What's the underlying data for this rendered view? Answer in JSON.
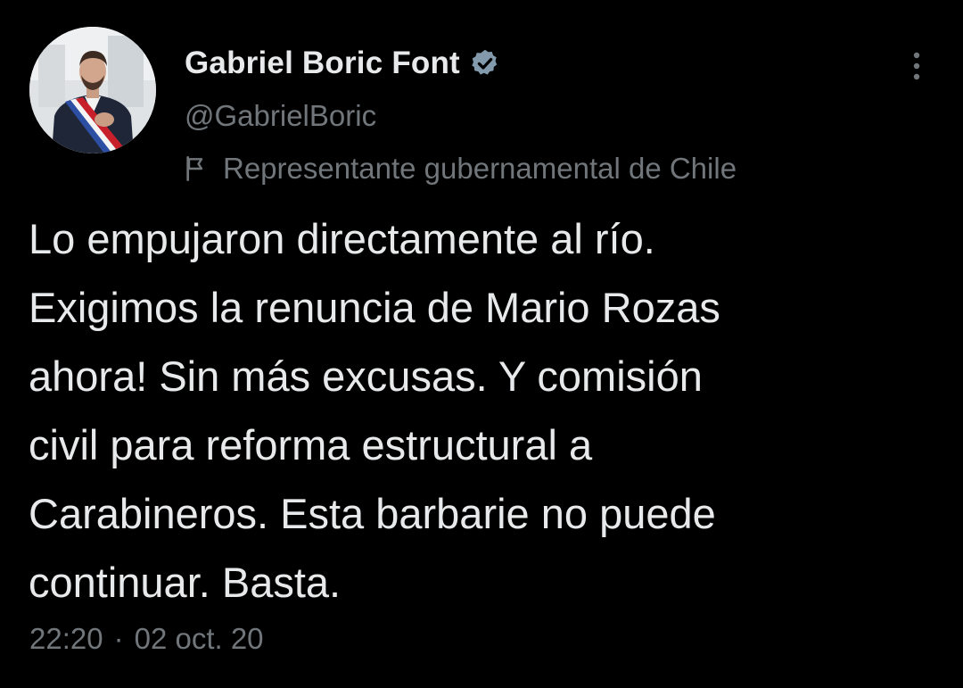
{
  "tweet": {
    "author": {
      "display_name": "Gabriel Boric Font",
      "handle": "@GabrielBoric",
      "verified": true,
      "avatar_icon": "profile-photo",
      "label_icon": "flag-icon",
      "label": "Representante gubernamental de Chile"
    },
    "text": "Lo empujaron directamente al río.\nExigimos la renuncia de Mario Rozas\nahora! Sin más excusas. Y comisión\ncivil para reforma estructural a\nCarabineros. Esta barbarie no puede\ncontinuar. Basta.",
    "time": "22:20",
    "separator": "·",
    "date": "02 oct. 20",
    "more_icon": "more-vertical-icon"
  },
  "colors": {
    "background": "#000000",
    "primary_text": "#e7e9ea",
    "secondary_text": "#71767b",
    "verified_badge": "#829aab"
  }
}
